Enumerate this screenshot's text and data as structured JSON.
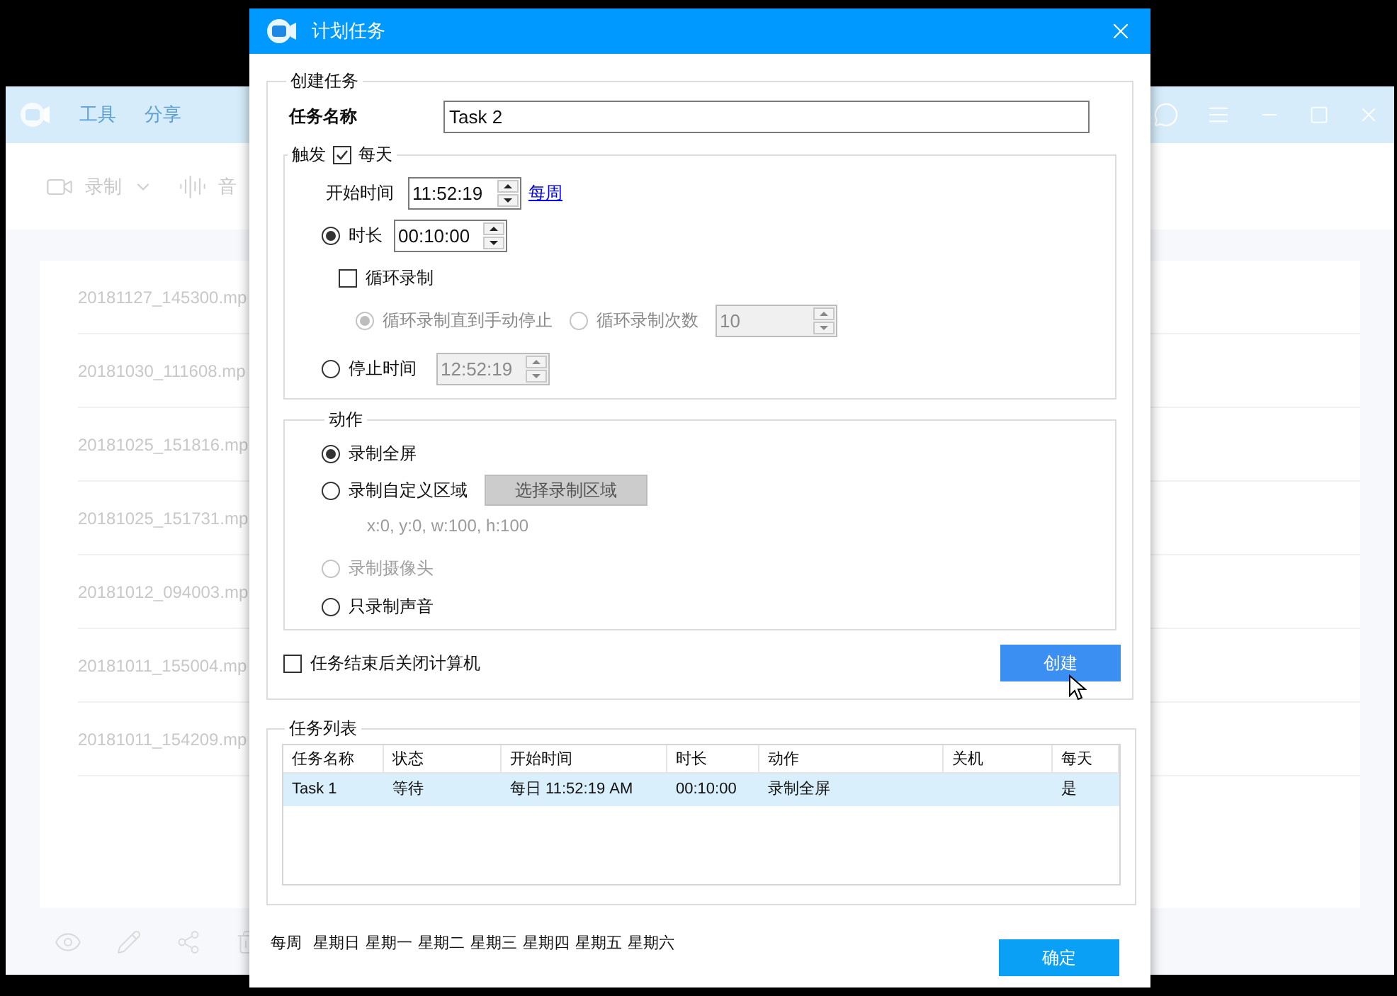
{
  "background_window": {
    "menu": [
      "工具",
      "分享"
    ],
    "toolbar": [
      {
        "kind": "record",
        "label": "录制"
      },
      {
        "kind": "audio",
        "label": "音"
      }
    ],
    "files": [
      "20181127_145300.mp",
      "20181030_111608.mp",
      "20181025_151816.mp",
      "20181025_151731.mp",
      "20181012_094003.mp",
      "20181011_155004.mp",
      "20181011_154209.mp"
    ]
  },
  "dialog": {
    "title": "计划任务",
    "create_task": {
      "legend": "创建任务",
      "name_label": "任务名称",
      "name_value": "Task 2",
      "trigger": {
        "legend": "触发",
        "daily_label": "每天",
        "daily_checked": true,
        "start_label": "开始时间",
        "start_value": "11:52:19",
        "weekly_link": "每周",
        "duration": {
          "label": "时长",
          "selected": true,
          "value": "00:10:00"
        },
        "loop": {
          "label": "循环录制",
          "checked": false,
          "options": [
            {
              "label": "循环录制直到手动停止",
              "selected": true,
              "disabled": true
            },
            {
              "label": "循环录制次数",
              "selected": false,
              "disabled": true
            }
          ],
          "count_value": "10",
          "count_disabled": true
        },
        "stop": {
          "label": "停止时间",
          "selected": false,
          "value": "12:52:19",
          "value_disabled": true
        }
      },
      "action": {
        "legend": "动作",
        "options": [
          {
            "kind": "plain",
            "label": "录制全屏",
            "selected": true,
            "disabled": false
          },
          {
            "kind": "region",
            "label": "录制自定义区域",
            "selected": false,
            "disabled": false,
            "button": "选择录制区域",
            "coords": "x:0, y:0, w:100, h:100"
          },
          {
            "kind": "plain",
            "label": "录制摄像头",
            "selected": false,
            "disabled": true
          },
          {
            "kind": "plain",
            "label": "只录制声音",
            "selected": false,
            "disabled": false
          }
        ]
      },
      "shutdown_label": "任务结束后关闭计算机",
      "shutdown_checked": false,
      "create_button": "创建"
    },
    "task_list": {
      "legend": "任务列表",
      "columns": [
        "任务名称",
        "状态",
        "开始时间",
        "时长",
        "动作",
        "关机",
        "每天"
      ],
      "rows": [
        {
          "selected": true,
          "task_name": "Task 1",
          "status": "等待",
          "start_time": "每日 11:52:19 AM",
          "duration": "00:10:00",
          "action": "录制全屏",
          "daily": "是"
        }
      ]
    },
    "weekdays": {
      "label": "每周",
      "days": [
        "星期日",
        "星期一",
        "星期二",
        "星期三",
        "星期四",
        "星期五",
        "星期六"
      ]
    },
    "ok_button": "确定"
  }
}
